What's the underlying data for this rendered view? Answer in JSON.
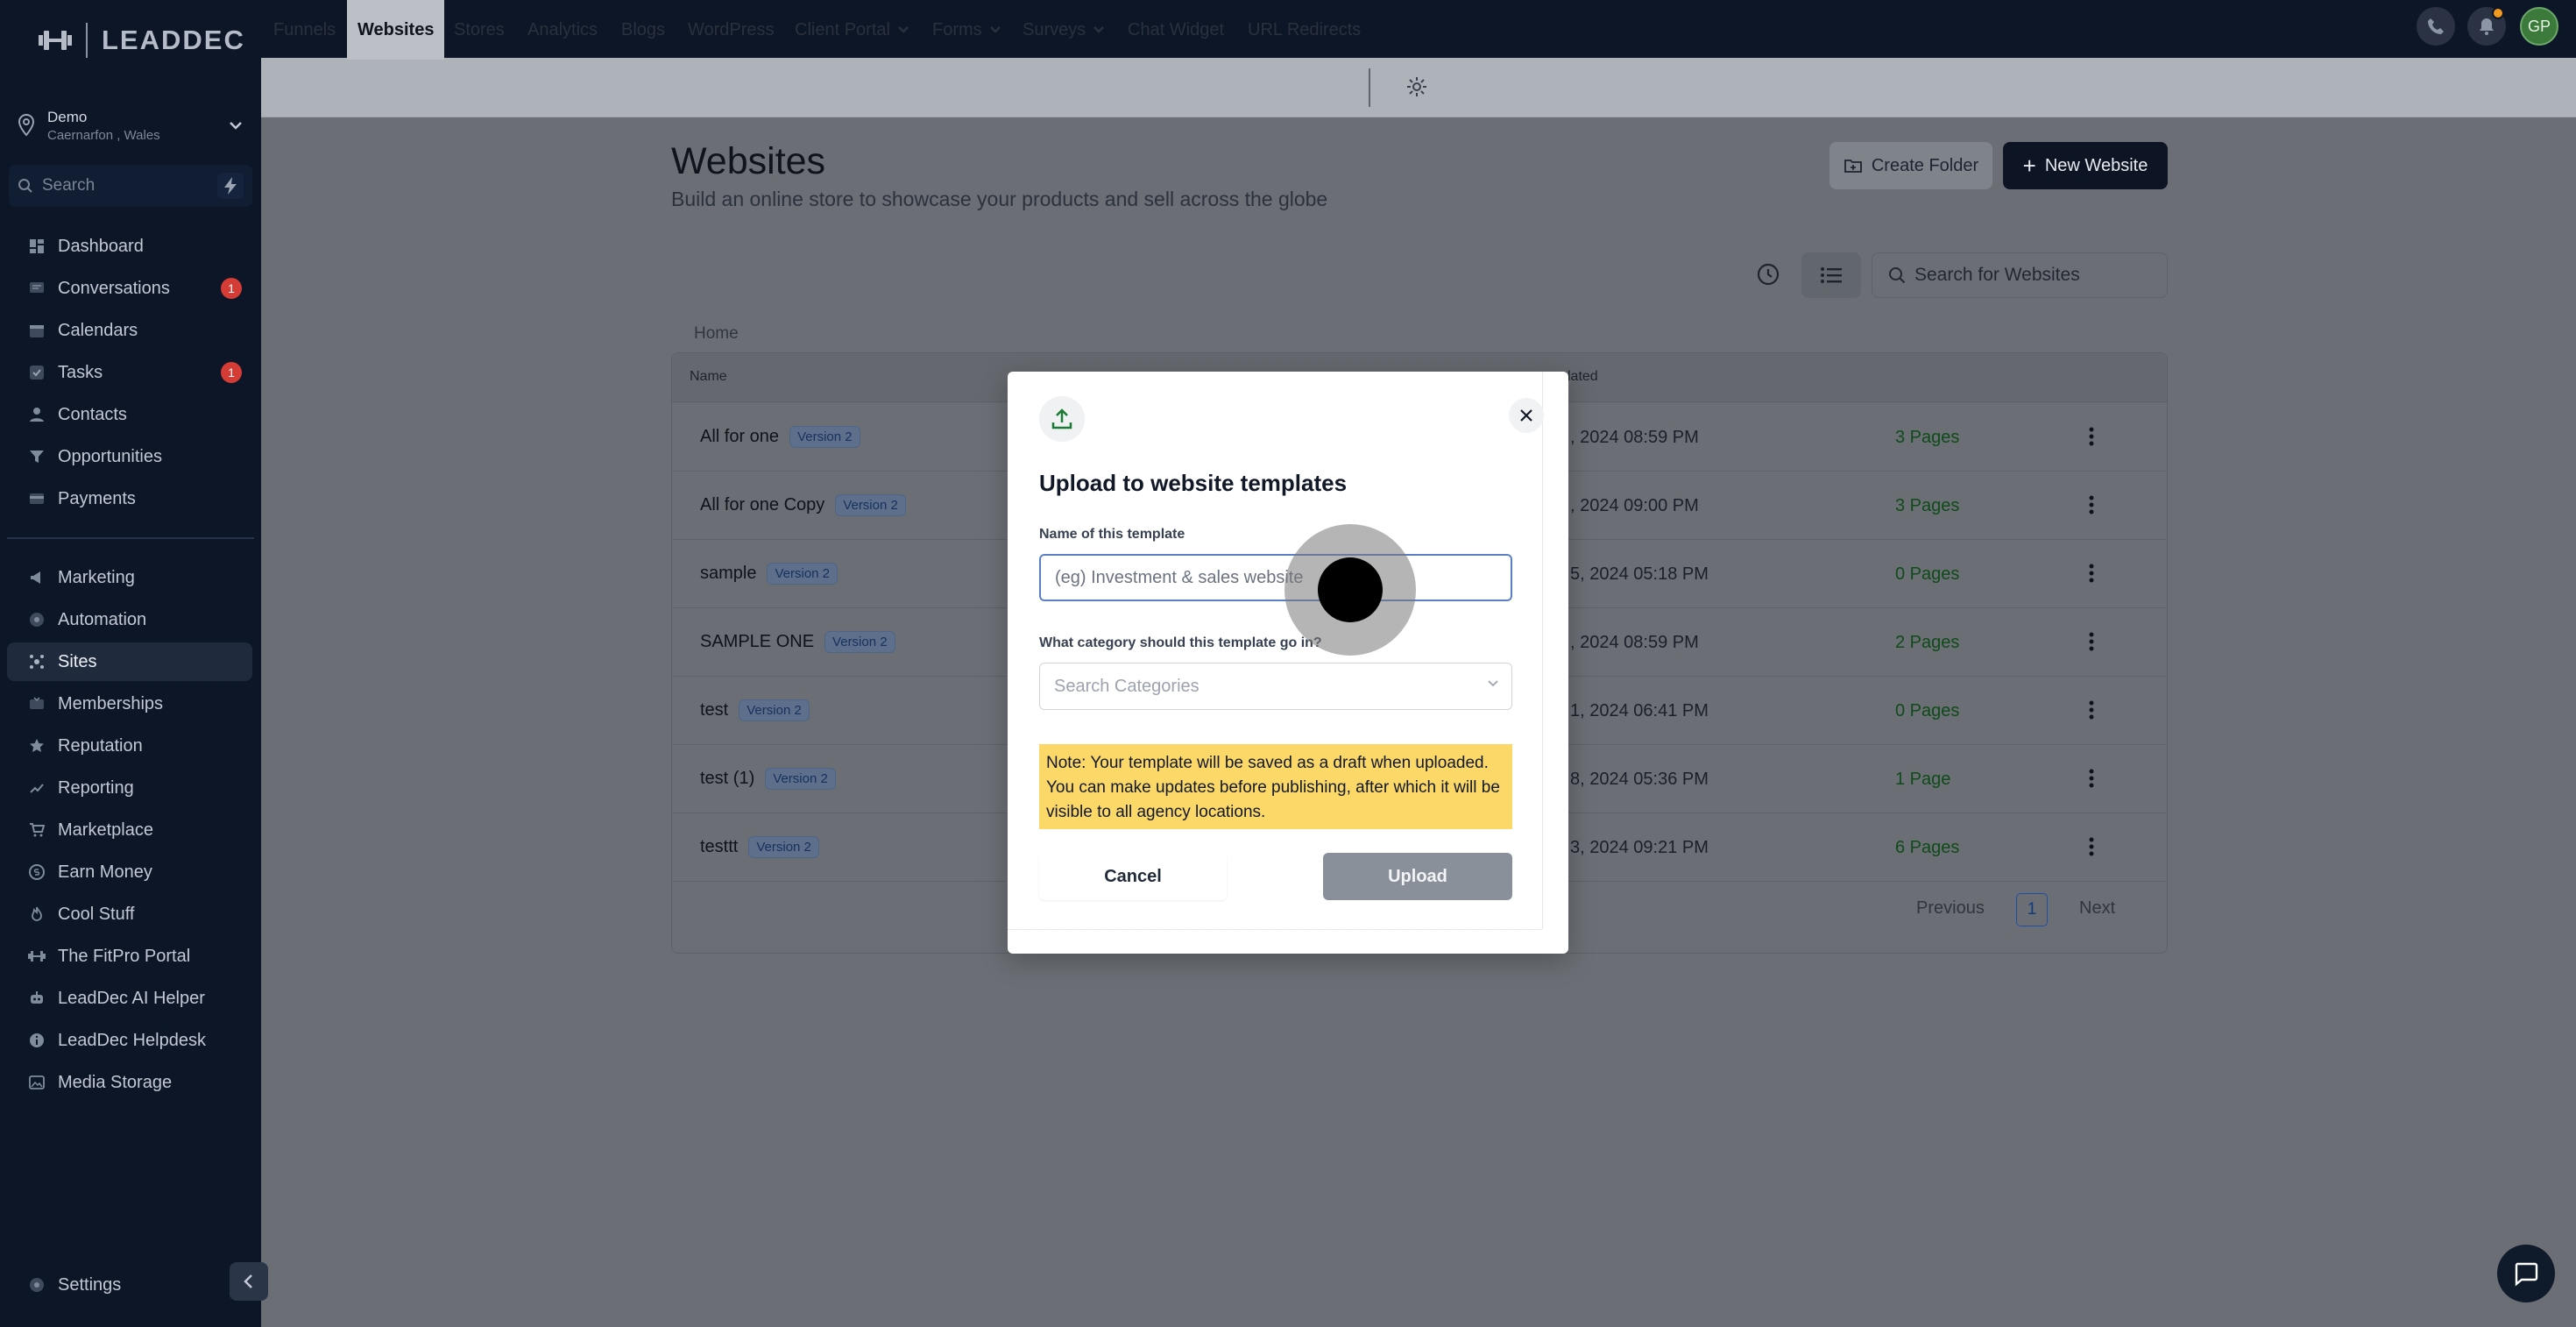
{
  "sidebar": {
    "logo": "LEADDEC",
    "location": {
      "name": "Demo",
      "sub": "Caernarfon , Wales"
    },
    "search_placeholder": "Search",
    "items": [
      {
        "label": "Dashboard",
        "icon": "dashboard-icon"
      },
      {
        "label": "Conversations",
        "icon": "chat-icon",
        "badge": "1"
      },
      {
        "label": "Calendars",
        "icon": "calendar-icon"
      },
      {
        "label": "Tasks",
        "icon": "check-icon",
        "badge": "1"
      },
      {
        "label": "Contacts",
        "icon": "user-icon"
      },
      {
        "label": "Opportunities",
        "icon": "filter-icon"
      },
      {
        "label": "Payments",
        "icon": "card-icon"
      },
      {
        "label": "Marketing",
        "icon": "megaphone-icon"
      },
      {
        "label": "Automation",
        "icon": "automation-icon"
      },
      {
        "label": "Sites",
        "icon": "sites-icon",
        "active": true
      },
      {
        "label": "Memberships",
        "icon": "memberships-icon"
      },
      {
        "label": "Reputation",
        "icon": "star-icon"
      },
      {
        "label": "Reporting",
        "icon": "chart-icon"
      },
      {
        "label": "Marketplace",
        "icon": "cart-icon"
      },
      {
        "label": "Earn Money",
        "icon": "money-icon"
      },
      {
        "label": "Cool Stuff",
        "icon": "flame-icon"
      },
      {
        "label": "The FitPro Portal",
        "icon": "dumbbell-icon"
      },
      {
        "label": "LeadDec AI Helper",
        "icon": "robot-icon"
      },
      {
        "label": "LeadDec Helpdesk",
        "icon": "info-icon"
      },
      {
        "label": "Media Storage",
        "icon": "image-icon"
      }
    ],
    "settings": "Settings"
  },
  "subnav": {
    "tabs": [
      "Funnels",
      "Websites",
      "Stores",
      "Analytics",
      "Blogs",
      "WordPress",
      "Client Portal",
      "Forms",
      "Surveys",
      "Chat Widget",
      "URL Redirects"
    ],
    "active_tab": "Websites"
  },
  "page": {
    "title": "Websites",
    "subtitle": "Build an online store to showcase your products and sell across the globe",
    "create_folder": "Create Folder",
    "new_website": "New Website",
    "search_placeholder": "Search for Websites",
    "breadcrumb": "Home"
  },
  "table": {
    "headers": {
      "name": "Name",
      "updated": "lated"
    },
    "rows": [
      {
        "name": "All for one",
        "version": "Version 2",
        "date": ", 2024 08:59 PM",
        "pages": "3 Pages"
      },
      {
        "name": "All for one Copy",
        "version": "Version 2",
        "date": ", 2024 09:00 PM",
        "pages": "3 Pages"
      },
      {
        "name": "sample",
        "version": "Version 2",
        "date": "5, 2024 05:18 PM",
        "pages": "0 Pages"
      },
      {
        "name": "SAMPLE ONE",
        "version": "Version 2",
        "date": ", 2024 08:59 PM",
        "pages": "2 Pages"
      },
      {
        "name": "test",
        "version": "Version 2",
        "date": "1, 2024 06:41 PM",
        "pages": "0 Pages"
      },
      {
        "name": "test (1)",
        "version": "Version 2",
        "date": "8, 2024 05:36 PM",
        "pages": "1 Page"
      },
      {
        "name": "testtt",
        "version": "Version 2",
        "date": "3, 2024 09:21 PM",
        "pages": "6 Pages"
      }
    ],
    "pager": {
      "previous": "Previous",
      "current": "1",
      "next": "Next"
    }
  },
  "modal": {
    "title": "Upload to website templates",
    "name_label": "Name of this template",
    "name_placeholder": "(eg) Investment & sales website",
    "category_label": "What category should this template go in?",
    "category_placeholder": "Search Categories",
    "note": "Note: Your template will be saved as a draft when uploaded. You can make updates before publishing, after which it will be visible to all agency locations.",
    "cancel": "Cancel",
    "upload": "Upload"
  },
  "topbar": {
    "avatar_initials": "GP"
  },
  "colors": {
    "sidebar_bg": "#0c1627",
    "primary": "#0d1524",
    "success": "#0f4a19",
    "note_bg": "#fcd868"
  }
}
